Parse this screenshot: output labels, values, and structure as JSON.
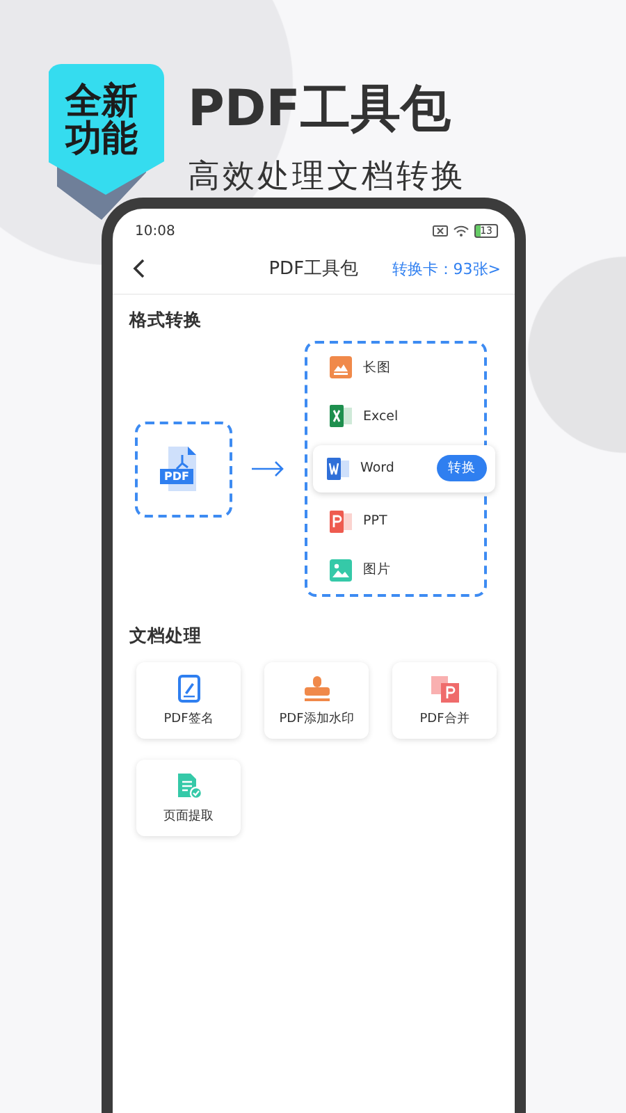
{
  "badge": "全新功能",
  "headline": {
    "title": "PDF工具包",
    "subtitle": "高效处理文档转换"
  },
  "status_bar": {
    "time": "10:08",
    "battery": "13"
  },
  "nav": {
    "title": "PDF工具包",
    "link": "转换卡：93张>"
  },
  "convert": {
    "heading": "格式转换",
    "source": "PDF",
    "targets": [
      {
        "kind": "long-image",
        "label": "长图",
        "selected": false
      },
      {
        "kind": "excel",
        "label": "Excel",
        "selected": false
      },
      {
        "kind": "word",
        "label": "Word",
        "selected": true,
        "button": "转换"
      },
      {
        "kind": "ppt",
        "label": "PPT",
        "selected": false
      },
      {
        "kind": "picture",
        "label": "图片",
        "selected": false
      }
    ]
  },
  "tools": {
    "heading": "文档处理",
    "items": [
      {
        "kind": "sign",
        "label": "PDF签名"
      },
      {
        "kind": "stamp",
        "label": "PDF添加水印"
      },
      {
        "kind": "merge",
        "label": "PDF合并"
      },
      {
        "kind": "extract",
        "label": "页面提取"
      }
    ]
  }
}
